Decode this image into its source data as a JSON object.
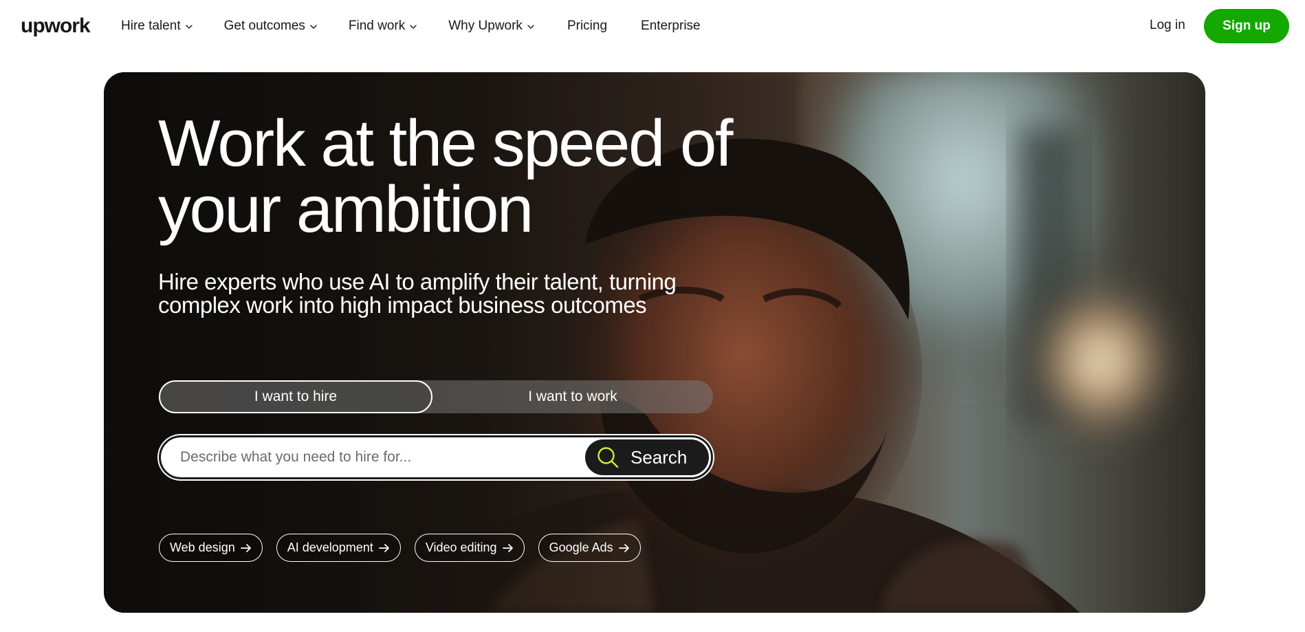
{
  "brand": {
    "logo_text": "upwork",
    "accent_color": "#14a800"
  },
  "nav": {
    "items": [
      {
        "label": "Hire talent",
        "has_dropdown": true
      },
      {
        "label": "Get outcomes",
        "has_dropdown": true
      },
      {
        "label": "Find work",
        "has_dropdown": true
      },
      {
        "label": "Why Upwork",
        "has_dropdown": true
      },
      {
        "label": "Pricing",
        "has_dropdown": false
      },
      {
        "label": "Enterprise",
        "has_dropdown": false
      }
    ],
    "login_label": "Log in",
    "signup_label": "Sign up"
  },
  "hero": {
    "headline_line1": "Work at the speed of",
    "headline_line2": "your ambition",
    "subhead_line1": "Hire experts who use AI to amplify their talent, turning",
    "subhead_line2": "complex work into high impact business outcomes",
    "toggle": {
      "hire_label": "I want to hire",
      "work_label": "I want to work",
      "selected": "hire"
    },
    "search": {
      "placeholder": "Describe what you need to hire for...",
      "value": "",
      "button_label": "Search",
      "icon": "search-icon",
      "icon_color": "#c9f03b"
    },
    "suggestions": [
      {
        "label": "Web design",
        "icon": "arrow-right-icon"
      },
      {
        "label": "AI development",
        "icon": "arrow-right-icon"
      },
      {
        "label": "Video editing",
        "icon": "arrow-right-icon"
      },
      {
        "label": "Google Ads",
        "icon": "arrow-right-icon"
      }
    ]
  }
}
